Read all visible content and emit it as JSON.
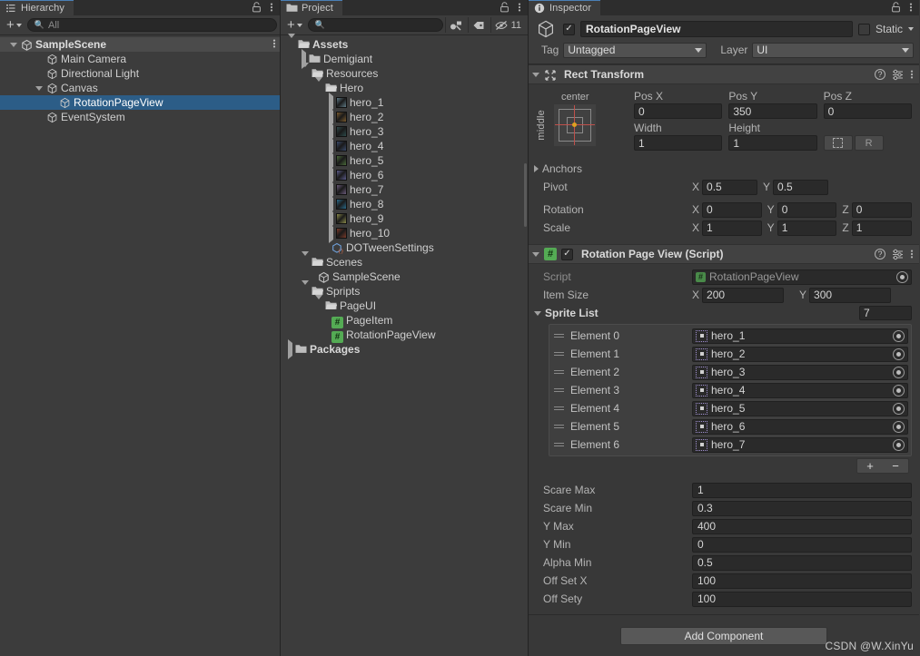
{
  "hierarchy": {
    "tab_label": "Hierarchy",
    "tab_icon": "hierarchy-icon",
    "lock_icon": "lock-icon",
    "menu_icon": "kebab-menu-icon",
    "toolbar": {
      "add_label": "+",
      "search_placeholder": "All",
      "search_value": ""
    },
    "items": [
      {
        "label": "SampleScene",
        "depth": 0,
        "icon": "unity-scene-icon",
        "expanded": true,
        "selected": false,
        "is_scene": true,
        "has_menu": true
      },
      {
        "label": "Main Camera",
        "depth": 2,
        "icon": "gameobject-icon",
        "expanded": null,
        "selected": false,
        "is_scene": false,
        "has_menu": false
      },
      {
        "label": "Directional Light",
        "depth": 2,
        "icon": "gameobject-icon",
        "expanded": null,
        "selected": false,
        "is_scene": false,
        "has_menu": false
      },
      {
        "label": "Canvas",
        "depth": 2,
        "icon": "gameobject-icon",
        "expanded": true,
        "selected": false,
        "is_scene": false,
        "has_menu": false
      },
      {
        "label": "RotationPageView",
        "depth": 3,
        "icon": "gameobject-icon",
        "expanded": null,
        "selected": true,
        "is_scene": false,
        "has_menu": false
      },
      {
        "label": "EventSystem",
        "depth": 2,
        "icon": "gameobject-icon",
        "expanded": null,
        "selected": false,
        "is_scene": false,
        "has_menu": false
      }
    ]
  },
  "project": {
    "tab_label": "Project",
    "tab_icon": "folder-icon",
    "lock_icon": "lock-icon",
    "menu_icon": "kebab-menu-icon",
    "toolbar": {
      "add_label": "+",
      "search_placeholder": "",
      "search_value": "",
      "buttons": [
        {
          "name": "search-by-type-icon",
          "label": ""
        },
        {
          "name": "search-by-label-icon",
          "label": ""
        },
        {
          "name": "hidden-packages-icon",
          "label": "11"
        }
      ]
    },
    "items": [
      {
        "label": "Assets",
        "depth": 0,
        "icon": "folder-open-icon",
        "expanded": true,
        "bold": true
      },
      {
        "label": "Demigiant",
        "depth": 1,
        "icon": "folder-icon",
        "expanded": false,
        "bold": false
      },
      {
        "label": "Resources",
        "depth": 1,
        "icon": "folder-open-icon",
        "expanded": true,
        "bold": false
      },
      {
        "label": "Hero",
        "depth": 2,
        "icon": "folder-open-icon",
        "expanded": true,
        "bold": false
      },
      {
        "label": "hero_1",
        "depth": 3,
        "icon": "sprite-thumb",
        "expanded": false,
        "bold": false,
        "thumb": "#5f7a86"
      },
      {
        "label": "hero_2",
        "depth": 3,
        "icon": "sprite-thumb",
        "expanded": false,
        "bold": false,
        "thumb": "#7a5a2e"
      },
      {
        "label": "hero_3",
        "depth": 3,
        "icon": "sprite-thumb",
        "expanded": false,
        "bold": false,
        "thumb": "#2e4a4a"
      },
      {
        "label": "hero_4",
        "depth": 3,
        "icon": "sprite-thumb",
        "expanded": false,
        "bold": false,
        "thumb": "#3a4a6a"
      },
      {
        "label": "hero_5",
        "depth": 3,
        "icon": "sprite-thumb",
        "expanded": false,
        "bold": false,
        "thumb": "#4a6a3a"
      },
      {
        "label": "hero_6",
        "depth": 3,
        "icon": "sprite-thumb",
        "expanded": false,
        "bold": false,
        "thumb": "#5a5a8a"
      },
      {
        "label": "hero_7",
        "depth": 3,
        "icon": "sprite-thumb",
        "expanded": false,
        "bold": false,
        "thumb": "#6a5a7a"
      },
      {
        "label": "hero_8",
        "depth": 3,
        "icon": "sprite-thumb",
        "expanded": false,
        "bold": false,
        "thumb": "#2a6a8a"
      },
      {
        "label": "hero_9",
        "depth": 3,
        "icon": "sprite-thumb",
        "expanded": false,
        "bold": false,
        "thumb": "#8a8a4a"
      },
      {
        "label": "hero_10",
        "depth": 3,
        "icon": "sprite-thumb",
        "expanded": false,
        "bold": false,
        "thumb": "#7a3a2a"
      },
      {
        "label": "DOTweenSettings",
        "depth": 3,
        "icon": "prefab-icon",
        "expanded": null,
        "bold": false
      },
      {
        "label": "Scenes",
        "depth": 1,
        "icon": "folder-open-icon",
        "expanded": true,
        "bold": false
      },
      {
        "label": "SampleScene",
        "depth": 2,
        "icon": "unity-scene-icon",
        "expanded": null,
        "bold": false
      },
      {
        "label": "Spripts",
        "depth": 1,
        "icon": "folder-open-icon",
        "expanded": true,
        "bold": false
      },
      {
        "label": "PageUI",
        "depth": 2,
        "icon": "folder-open-icon",
        "expanded": true,
        "bold": false
      },
      {
        "label": "PageItem",
        "depth": 3,
        "icon": "csharp-script-icon",
        "expanded": null,
        "bold": false
      },
      {
        "label": "RotationPageView",
        "depth": 3,
        "icon": "csharp-script-icon",
        "expanded": null,
        "bold": false
      },
      {
        "label": "Packages",
        "depth": 0,
        "icon": "folder-icon",
        "expanded": false,
        "bold": true
      }
    ]
  },
  "inspector": {
    "tab_label": "Inspector",
    "tab_icon": "info-icon",
    "lock_icon": "lock-icon",
    "menu_icon": "kebab-menu-icon",
    "object_header": {
      "enabled": true,
      "name": "RotationPageView",
      "static_label": "Static",
      "static_checked": false,
      "tag_label": "Tag",
      "tag_value": "Untagged",
      "layer_label": "Layer",
      "layer_value": "UI"
    },
    "rect_transform": {
      "title": "Rect Transform",
      "expanded": true,
      "anchor_preset": {
        "horizontal": "center",
        "vertical": "middle"
      },
      "pos_x_label": "Pos X",
      "pos_x": "0",
      "pos_y_label": "Pos Y",
      "pos_y": "350",
      "pos_z_label": "Pos Z",
      "pos_z": "0",
      "width_label": "Width",
      "width": "1",
      "height_label": "Height",
      "height": "1",
      "blueprint_icon": "blueprint-mode-icon",
      "raw_label": "R",
      "anchors_label": "Anchors",
      "pivot_label": "Pivot",
      "pivot_x": "0.5",
      "pivot_y": "0.5",
      "rotation_label": "Rotation",
      "rot_x": "0",
      "rot_y": "0",
      "rot_z": "0",
      "scale_label": "Scale",
      "scale_x": "1",
      "scale_y": "1",
      "scale_z": "1"
    },
    "script_component": {
      "title": "Rotation Page View (Script)",
      "enabled": true,
      "expanded": true,
      "script_label": "Script",
      "script_value": "RotationPageView",
      "item_size_label": "Item Size",
      "item_size_x": "200",
      "item_size_y": "300",
      "sprite_list_label": "Sprite List",
      "sprite_list_size": "7",
      "elements": [
        {
          "name": "Element 0",
          "value": "hero_1"
        },
        {
          "name": "Element 1",
          "value": "hero_2"
        },
        {
          "name": "Element 2",
          "value": "hero_3"
        },
        {
          "name": "Element 3",
          "value": "hero_4"
        },
        {
          "name": "Element 4",
          "value": "hero_5"
        },
        {
          "name": "Element 5",
          "value": "hero_6"
        },
        {
          "name": "Element 6",
          "value": "hero_7"
        }
      ],
      "add_label": "+",
      "remove_label": "−",
      "fields": [
        {
          "label": "Scare Max",
          "value": "1"
        },
        {
          "label": "Scare Min",
          "value": "0.3"
        },
        {
          "label": "Y Max",
          "value": "400"
        },
        {
          "label": "Y Min",
          "value": "0"
        },
        {
          "label": "Alpha Min",
          "value": "0.5"
        },
        {
          "label": "Off Set X",
          "value": "100"
        },
        {
          "label": "Off Sety",
          "value": "100"
        }
      ]
    },
    "add_component_label": "Add Component",
    "watermark": "CSDN @W.XinYu"
  },
  "colors": {
    "selection_blue": "#2c5d87",
    "tab_accent": "#4a7fb5",
    "panel_bg": "#383838",
    "tree_bg": "#3c3c3c",
    "field_bg": "#2a2a2a",
    "script_icon_green": "#54ab54",
    "pivot_orange": "#e0a020",
    "axis_red": "#c0504b"
  }
}
